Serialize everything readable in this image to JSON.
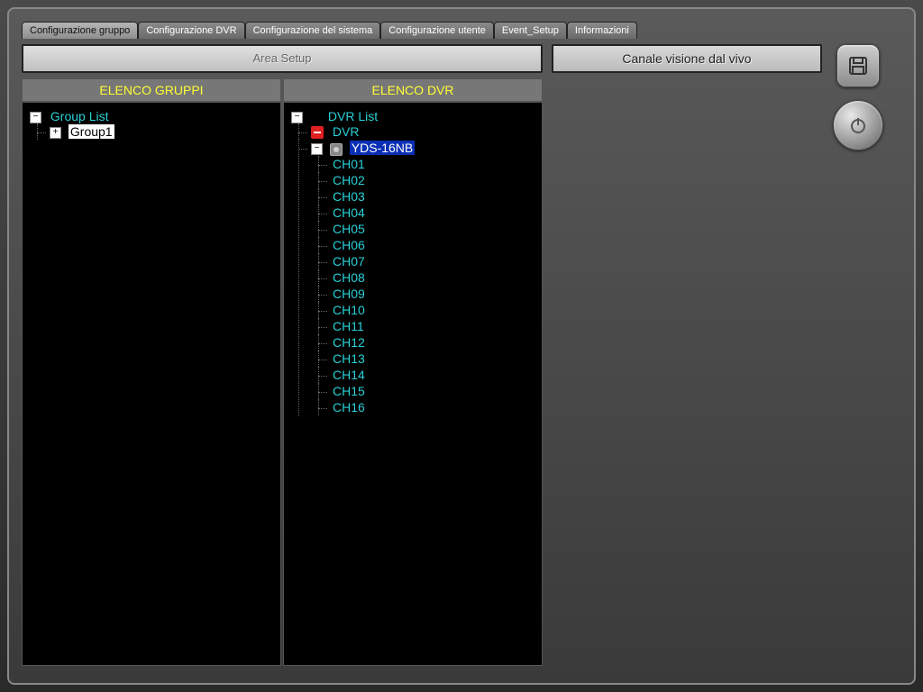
{
  "tabs": [
    {
      "label": "Configurazione gruppo",
      "active": true
    },
    {
      "label": "Configurazione DVR",
      "active": false
    },
    {
      "label": "Configurazione del sistema",
      "active": false
    },
    {
      "label": "Configurazione utente",
      "active": false
    },
    {
      "label": "Event_Setup",
      "active": false
    },
    {
      "label": "Informazioni",
      "active": false
    }
  ],
  "buttons": {
    "area_setup": "Area Setup",
    "live_channel": "Canale visione dal vivo"
  },
  "headers": {
    "groups": "ELENCO GRUPPI",
    "dvrs": "ELENCO DVR"
  },
  "group_tree": {
    "root": "Group List",
    "items": [
      "Group1"
    ]
  },
  "dvr_tree": {
    "root": "DVR List",
    "dvr_node": "DVR",
    "device": "YDS-16NB",
    "channels": [
      "CH01",
      "CH02",
      "CH03",
      "CH04",
      "CH05",
      "CH06",
      "CH07",
      "CH08",
      "CH09",
      "CH10",
      "CH11",
      "CH12",
      "CH13",
      "CH14",
      "CH15",
      "CH16"
    ]
  },
  "icons": {
    "save": "save-icon",
    "power": "power-icon"
  },
  "expanders": {
    "minus": "−",
    "plus": "+"
  }
}
